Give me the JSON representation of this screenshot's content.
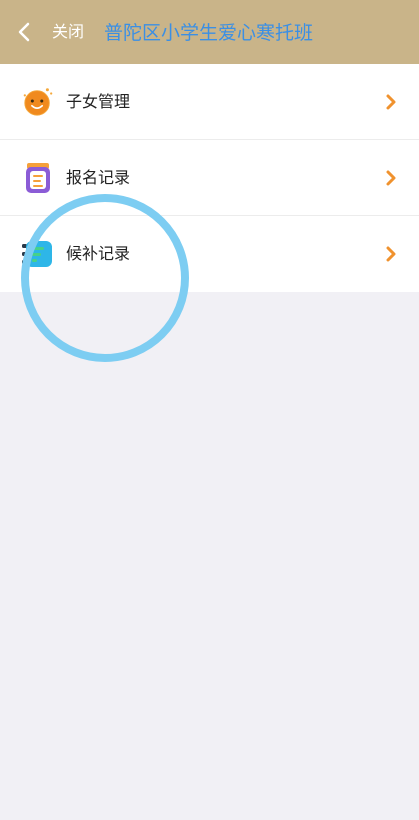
{
  "header": {
    "close_label": "关闭",
    "title": "普陀区小学生爱心寒托班",
    "background_color": "#c9b489",
    "title_color": "#3b8fe4"
  },
  "menu": {
    "items": [
      {
        "label": "子女管理",
        "icon": "child-face-icon"
      },
      {
        "label": "报名记录",
        "icon": "registration-record-icon"
      },
      {
        "label": "候补记录",
        "icon": "waitlist-record-icon"
      }
    ],
    "chevron_color": "#f0922e"
  },
  "colors": {
    "page_background": "#f1f0f5",
    "touch_indicator": "#7dcdf2"
  }
}
